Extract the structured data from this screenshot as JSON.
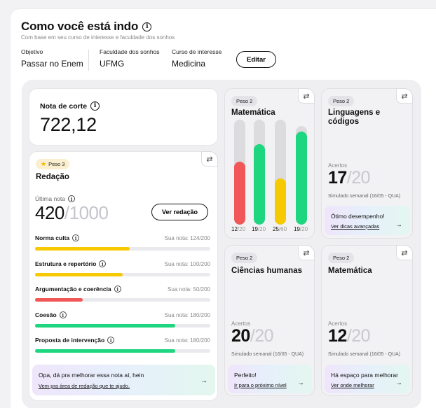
{
  "header": {
    "title": "Como você está indo",
    "subtitle": "Com base em seu curso de interesse e faculdade dos sonhos",
    "edit_label": "Editar"
  },
  "meta": [
    {
      "label": "Objetivo",
      "value": "Passar no Enem"
    },
    {
      "label": "Faculdade dos sonhos",
      "value": "UFMG"
    },
    {
      "label": "Curso de interesse",
      "value": "Medicina"
    }
  ],
  "nota_corte": {
    "label": "Nota de corte",
    "value": "722,12"
  },
  "redacao": {
    "peso": "Peso 3",
    "title": "Redação",
    "ultima_label": "Última nota",
    "score": "420",
    "max": "/1000",
    "ver_label": "Ver redação",
    "criteria": [
      {
        "name": "Norma culta",
        "score": "Sua nota: 124/200",
        "fraction": 0.54,
        "color": "#f6c900"
      },
      {
        "name": "Estrutura e repertório",
        "score": "Sua nota: 100/200",
        "fraction": 0.5,
        "color": "#f6c900"
      },
      {
        "name": "Argumentação e coerência",
        "score": "Sua nota: 50/200",
        "fraction": 0.27,
        "color": "#f25757"
      },
      {
        "name": "Coesão",
        "score": "Sua nota: 180/200",
        "fraction": 0.8,
        "color": "#1ed67f"
      },
      {
        "name": "Proposta de intervenção",
        "score": "Sua nota: 180/200",
        "fraction": 0.8,
        "color": "#1ed67f"
      }
    ],
    "tip_text": "Opa, dá pra melhorar essa nota aí, hein",
    "tip_link": "Vem pra área de redação que te ajudo."
  },
  "matematica_bars": {
    "peso": "Peso 2",
    "title": "Matemática",
    "bars": [
      {
        "num": "12",
        "den": "/20",
        "fraction": 0.6,
        "track_fraction": 1.0,
        "color": "#f25757"
      },
      {
        "num": "19",
        "den": "/20",
        "fraction": 0.77,
        "track_fraction": 1.0,
        "color": "#1ed67f"
      },
      {
        "num": "25",
        "den": "/60",
        "fraction": 0.44,
        "track_fraction": 1.0,
        "color": "#f6c900"
      },
      {
        "num": "19",
        "den": "/20",
        "fraction": 0.89,
        "track_fraction": 0.94,
        "color": "#1ed67f"
      }
    ]
  },
  "linguagens": {
    "peso": "Peso 2",
    "title": "Linguagens e códigos",
    "acertos_label": "Acertos",
    "value": "17",
    "den": "/20",
    "sim": "Simulado semanal (16/05 - QUA)",
    "tip_text": "Ótimo desempenho!",
    "tip_link": "Ver dicas avançadas"
  },
  "humanas": {
    "peso": "Peso 2",
    "title": "Ciências humanas",
    "acertos_label": "Acertos",
    "value": "20",
    "den": "/20",
    "sim": "Simulado semanal (16/05 - QUA)",
    "tip_text": "Perfeito!",
    "tip_link": "Ir para o próximo nível"
  },
  "matematica2": {
    "peso": "Peso 2",
    "title": "Matemática",
    "acertos_label": "Acertos",
    "value": "12",
    "den": "/20",
    "sim": "Simulado semanal (16/05 - QUA)",
    "tip_text": "Há espaço para melhorar",
    "tip_link": "Ver onde melhorar"
  },
  "icons": {
    "info": "info-icon",
    "swap": "swap-icon",
    "arrow": "arrow-right-icon",
    "star": "star-icon"
  }
}
